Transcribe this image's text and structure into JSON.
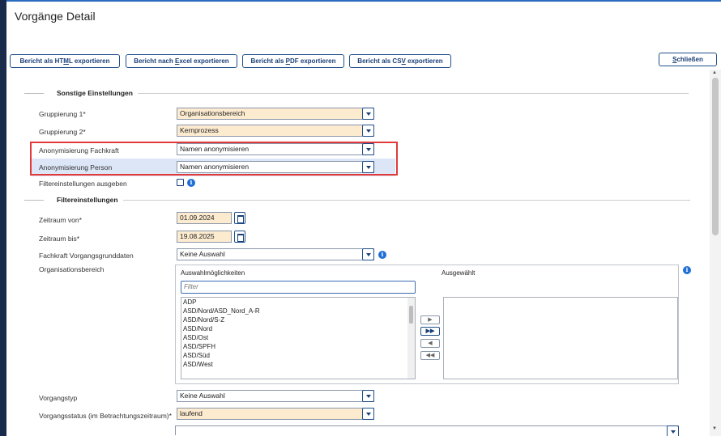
{
  "page": {
    "title": "Vorgänge Detail"
  },
  "toolbar": {
    "export_html_pre": "Bericht als HT",
    "export_html_key": "M",
    "export_html_post": "L exportieren",
    "export_excel_pre": "Bericht nach ",
    "export_excel_key": "E",
    "export_excel_post": "xcel exportieren",
    "export_pdf_pre": "Bericht als ",
    "export_pdf_key": "P",
    "export_pdf_post": "DF exportieren",
    "export_csv_pre": "Bericht als CS",
    "export_csv_key": "V",
    "export_csv_post": " exportieren",
    "close_key": "S",
    "close_post": "chließen"
  },
  "sections": {
    "sonstige": "Sonstige Einstellungen",
    "filter": "Filtereinstellungen"
  },
  "fields": {
    "gruppierung1": {
      "label": "Gruppierung 1*",
      "value": "Organisationsbereich"
    },
    "gruppierung2": {
      "label": "Gruppierung 2*",
      "value": "Kernprozess"
    },
    "anon_fachkraft": {
      "label": "Anonymisierung Fachkraft",
      "value": "Namen anonymisieren"
    },
    "anon_person": {
      "label": "Anonymisierung Person",
      "value": "Namen anonymisieren"
    },
    "filter_ausgeben": {
      "label": "Filtereinstellungen ausgeben",
      "checked": false
    },
    "zeitraum_von": {
      "label": "Zeitraum von*",
      "value": "01.09.2024"
    },
    "zeitraum_bis": {
      "label": "Zeitraum bis*",
      "value": "19.08.2025"
    },
    "fachkraft": {
      "label": "Fachkraft Vorgangsgrunddaten",
      "value": "Keine Auswahl"
    },
    "orgbereich": {
      "label": "Organisationsbereich"
    },
    "vorgangstyp": {
      "label": "Vorgangstyp",
      "value": "Keine Auswahl"
    },
    "vorgangsstatus": {
      "label": "Vorgangsstatus (im Betrachtungszeitraum)*",
      "value": "laufend"
    }
  },
  "picker": {
    "available_header": "Auswahlmöglichkeiten",
    "selected_header": "Ausgewählt",
    "filter_placeholder": "Filter",
    "items": [
      "ADP",
      "ASD/Nord/ASD_Nord_A-R",
      "ASD/Nord/S-Z",
      "ASD/Nord",
      "ASD/Ost",
      "ASD/SPFH",
      "ASD/Süd",
      "ASD/West"
    ],
    "move_right": "▶",
    "move_all_right": "▶▶",
    "move_left": "◀",
    "move_all_left": "◀◀"
  },
  "info_icon": "i"
}
